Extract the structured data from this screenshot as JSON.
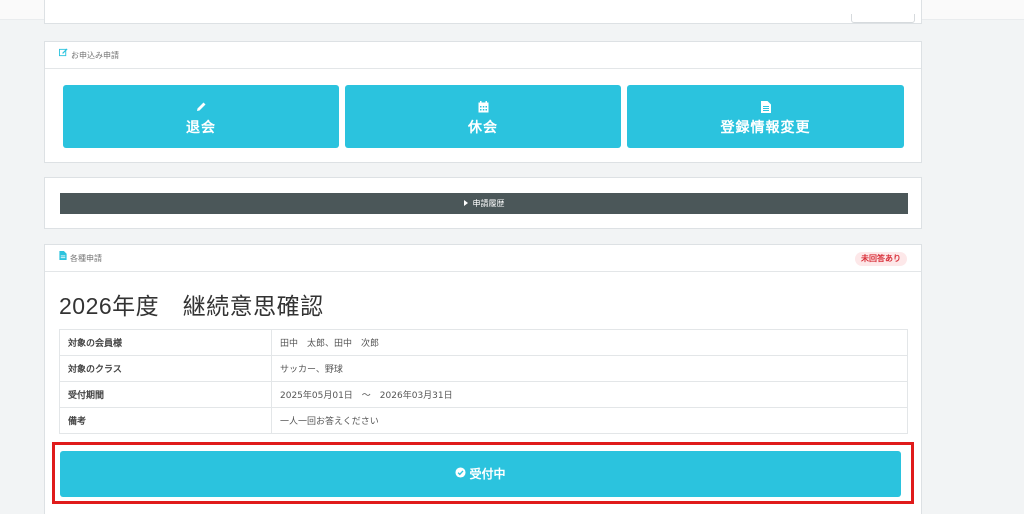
{
  "apply_panel": {
    "title": "お申込み申請",
    "buttons": [
      {
        "label": "退会",
        "icon": "pencil-icon"
      },
      {
        "label": "休会",
        "icon": "calendar-icon"
      },
      {
        "label": "登録情報変更",
        "icon": "document-icon"
      }
    ]
  },
  "history_panel": {
    "bar_label": "申請履歴"
  },
  "requests_panel": {
    "title": "各種申請",
    "badge": "未回答あり",
    "request_title": "2026年度　継続意思確認",
    "rows": [
      {
        "key": "対象の会員様",
        "value": "田中　太郎、田中　次郎"
      },
      {
        "key": "対象のクラス",
        "value": "サッカー、野球"
      },
      {
        "key": "受付期間",
        "value": "2025年05月01日　〜　2026年03月31日"
      },
      {
        "key": "備考",
        "value": "一人一回お答えください"
      }
    ],
    "accept_button": "受付中"
  },
  "colors": {
    "accent": "#2bc3de",
    "history_bar": "#4b5759",
    "badge_text": "#d9303a",
    "highlight": "#e01b1b"
  }
}
